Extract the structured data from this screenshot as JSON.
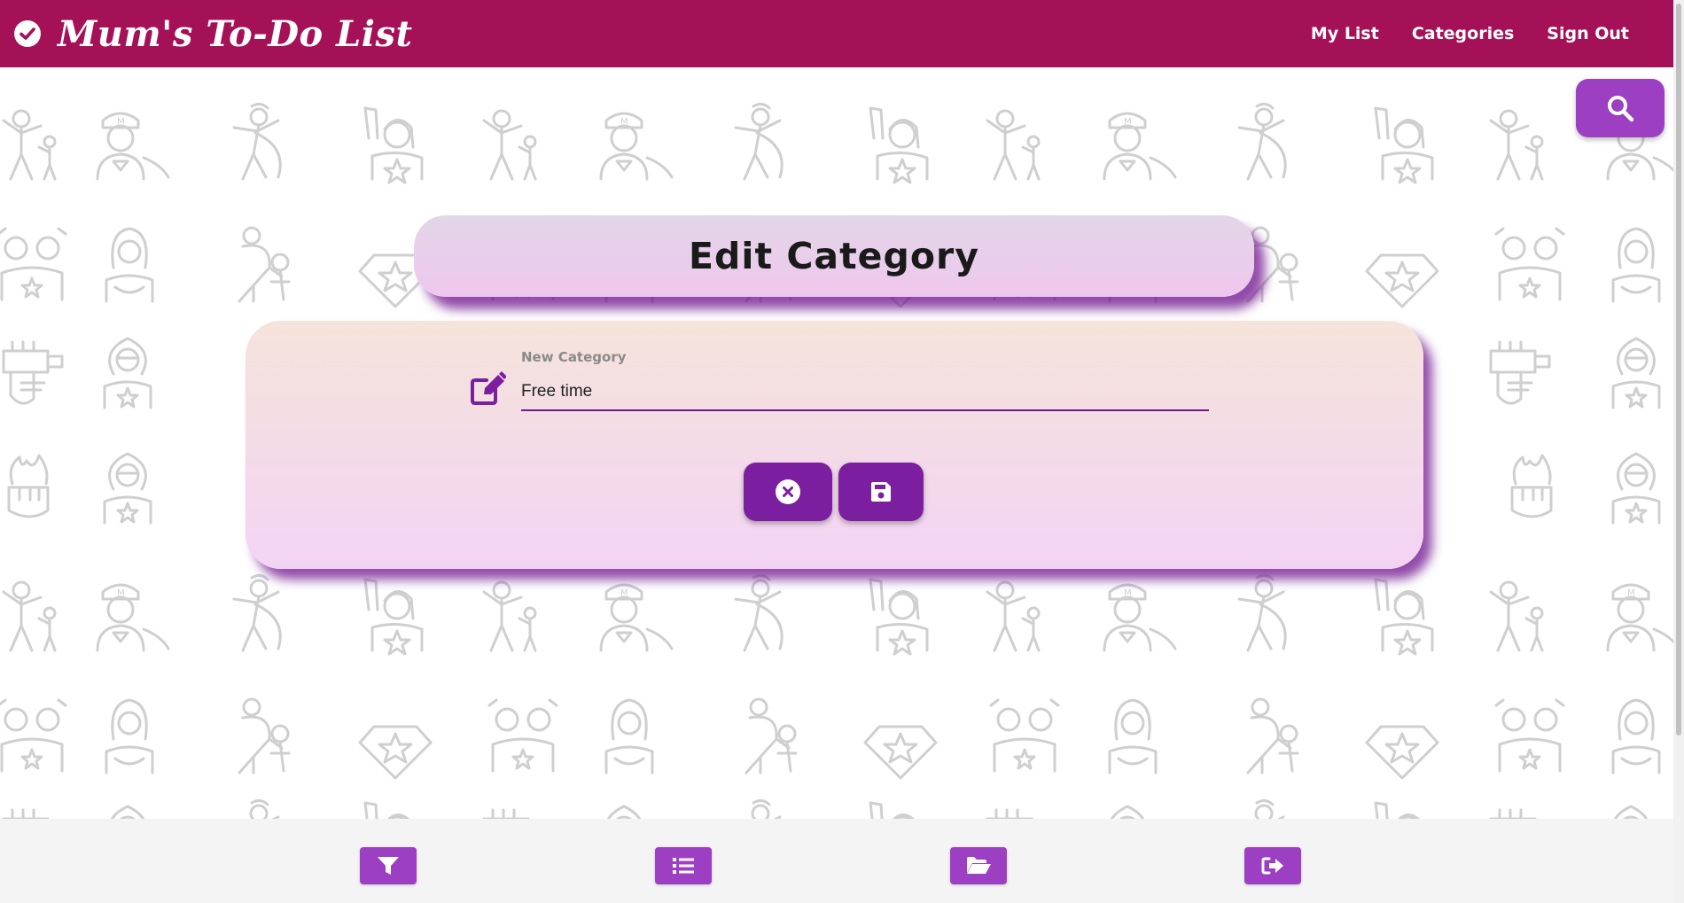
{
  "colors": {
    "navbar": "#a51157",
    "accent": "#9c3fc2",
    "button_dark": "#7b1ea0",
    "pattern_stroke": "#cfcfcf"
  },
  "navbar": {
    "brand_icon": "check-circle-icon",
    "title": "Mum's To-Do List",
    "links": [
      "My List",
      "Categories",
      "Sign Out"
    ]
  },
  "search": {
    "icon": "search-icon"
  },
  "page": {
    "title": "Edit Category"
  },
  "form": {
    "field_icon": "edit-icon",
    "label": "New Category",
    "value": "Free time",
    "cancel_icon": "times-circle-icon",
    "save_icon": "save-icon"
  },
  "footer": {
    "buttons": [
      "filter-icon",
      "list-icon",
      "folder-open-icon",
      "sign-out-icon"
    ]
  }
}
